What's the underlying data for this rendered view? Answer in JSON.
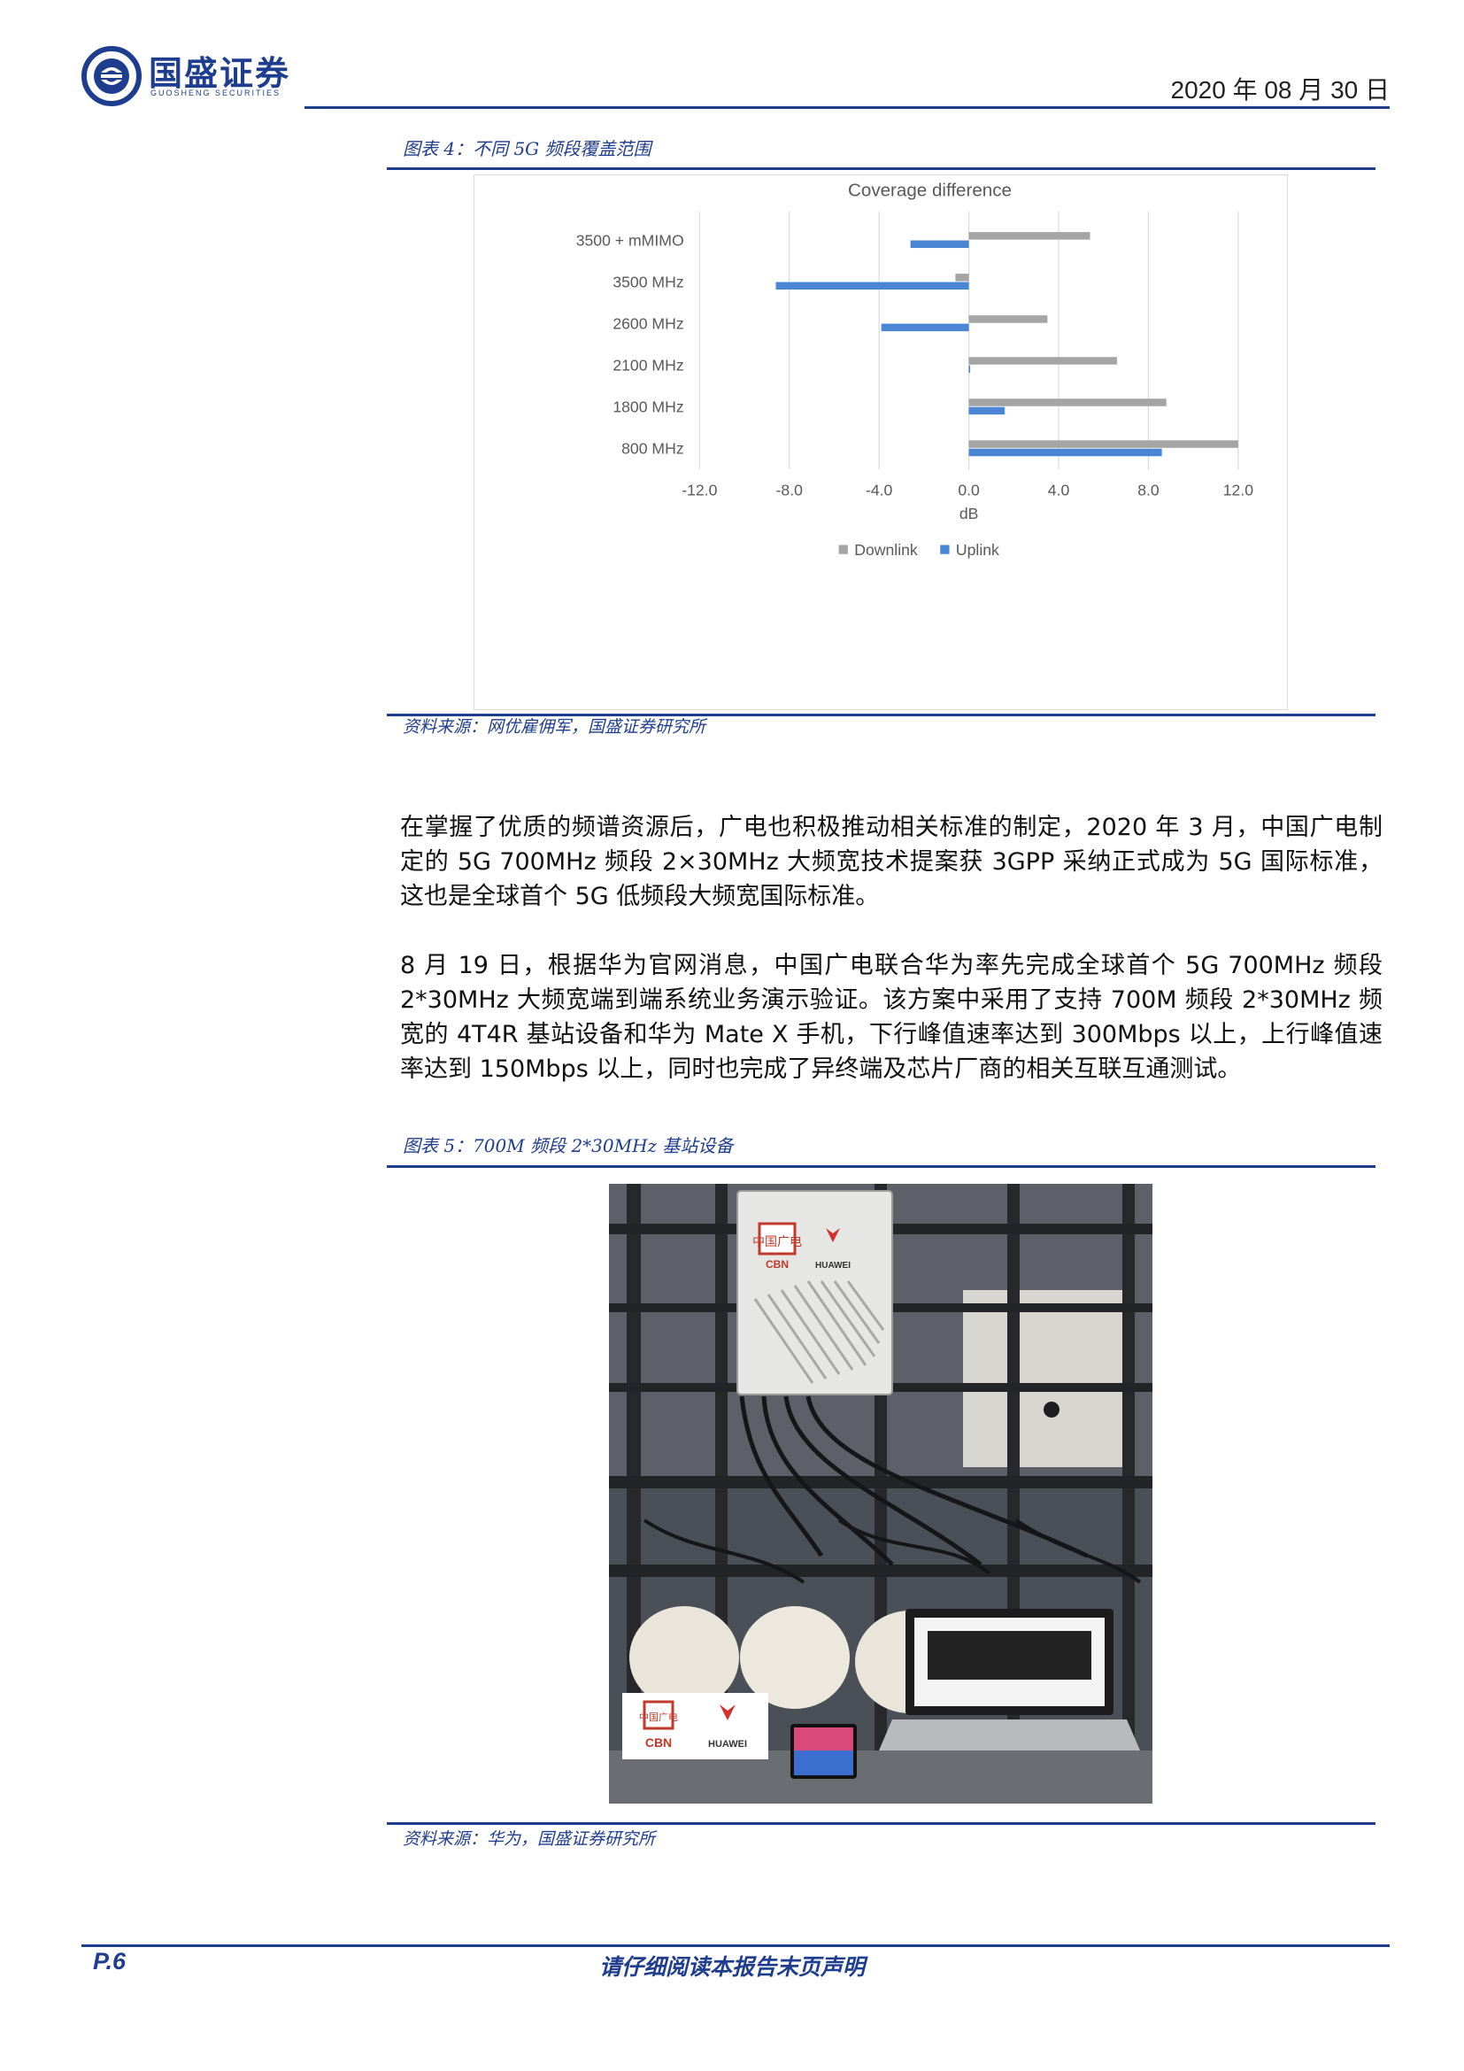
{
  "header": {
    "company_cn": "国盛证券",
    "company_en": "GUOSHENG SECURITIES",
    "date": "2020 年 08 月 30 日"
  },
  "figure4": {
    "title": "图表 4：不同 5G 频段覆盖范围",
    "source": "资料来源：网优雇佣军，国盛证券研究所"
  },
  "chart_data": {
    "type": "bar",
    "orientation": "horizontal",
    "title": "Coverage difference",
    "xlabel": "dB",
    "ylabel": "",
    "xlim": [
      -12.0,
      12.0
    ],
    "xticks": [
      "-12.0",
      "-8.0",
      "-4.0",
      "0.0",
      "4.0",
      "8.0",
      "12.0"
    ],
    "xtick_values": [
      -12,
      -8,
      -4,
      0,
      4,
      8,
      12
    ],
    "grid": "vertical",
    "legend_position": "bottom",
    "categories": [
      "3500 + mMIMO",
      "3500 MHz",
      "2600 MHz",
      "2100 MHz",
      "1800 MHz",
      "800 MHz"
    ],
    "series": [
      {
        "name": "Downlink",
        "color": "#a5a5a5",
        "values": [
          5.4,
          -0.6,
          3.5,
          6.6,
          8.8,
          12.0
        ]
      },
      {
        "name": "Uplink",
        "color": "#4a86d4",
        "values": [
          -2.6,
          -8.6,
          -3.9,
          0.0,
          1.6,
          8.6
        ]
      }
    ]
  },
  "paragraphs": [
    "在掌握了优质的频谱资源后，广电也积极推动相关标准的制定，2020 年 3 月，中国广电制定的 5G 700MHz 频段 2×30MHz 大频宽技术提案获 3GPP 采纳正式成为 5G 国际标准，这也是全球首个 5G 低频段大频宽国际标准。",
    "8 月 19 日，根据华为官网消息，中国广电联合华为率先完成全球首个 5G 700MHz 频段 2*30MHz 大频宽端到端系统业务演示验证。该方案中采用了支持 700M 频段 2*30MHz 频宽的 4T4R 基站设备和华为 Mate X 手机，下行峰值速率达到 300Mbps 以上，上行峰值速率达到 150Mbps 以上，同时也完成了异终端及芯片厂商的相关互联互通测试。"
  ],
  "figure5": {
    "title": "图表 5：700M 频段 2*30MHz 基站设备",
    "source": "资料来源：华为，国盛证券研究所",
    "photo_labels": {
      "cbn": "CBN",
      "huawei": "HUAWEI",
      "cn_logo": "中国广电"
    }
  },
  "footer": {
    "page": "P.6",
    "note": "请仔细阅读本报告末页声明"
  }
}
